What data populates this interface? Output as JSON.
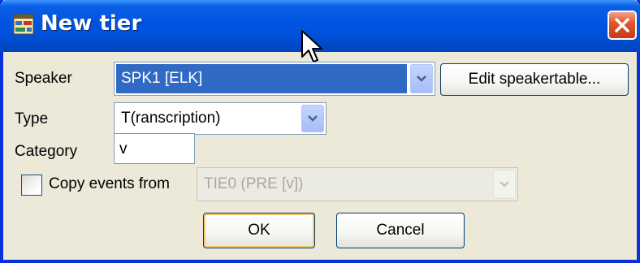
{
  "window": {
    "title": "New tier",
    "app_icon": "tier-grid-icon",
    "close_icon": "close-icon",
    "colors": {
      "titlebar": "#0054e3",
      "face": "#ece9d8",
      "selection": "#316ac5",
      "close": "#e2572c"
    }
  },
  "form": {
    "speaker": {
      "label": "Speaker",
      "value": "SPK1 [ELK]",
      "edit_button": "Edit speakertable..."
    },
    "type": {
      "label": "Type",
      "value": "T(ranscription)"
    },
    "category": {
      "label": "Category",
      "value": "v"
    },
    "copy_events": {
      "label": "Copy events from",
      "checked": false,
      "value": "TIE0 (PRE [v])",
      "enabled": false
    }
  },
  "buttons": {
    "ok": "OK",
    "cancel": "Cancel"
  }
}
